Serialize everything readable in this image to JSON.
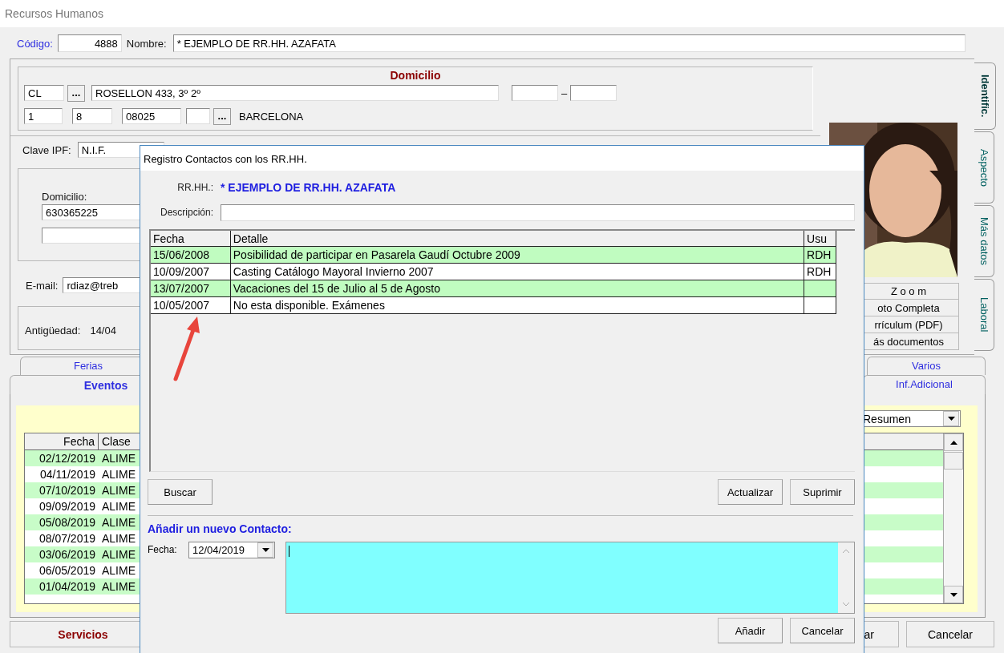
{
  "window": {
    "title": "Recursos Humanos"
  },
  "header": {
    "code_label": "Código:",
    "code": "4888",
    "name_label": "Nombre:",
    "name": "* EJEMPLO DE RR.HH. AZAFATA"
  },
  "address": {
    "title": "Domicilio",
    "street_type": "CL",
    "more_button": "...",
    "street": "ROSELLON 433, 3º 2º",
    "dash": "–",
    "field_1": "1",
    "field_2": "8",
    "postal_code": "08025",
    "city_button": "...",
    "city": "BARCELONA"
  },
  "id_key": {
    "label": "Clave IPF:",
    "value": "N.I.F."
  },
  "contact": {
    "label": "Domicilio:",
    "phone": "630365225"
  },
  "email": {
    "label": "E-mail:",
    "value": "rdiaz@treb"
  },
  "seniority": {
    "label": "Antigüedad:",
    "value": "14/04"
  },
  "photo": {
    "kind": "picture"
  },
  "photo_buttons": [
    "Z o o m",
    "oto Completa",
    "rrículum (PDF)",
    "ás documentos"
  ],
  "side_tabs": [
    {
      "label": "Identific.",
      "selected": true
    },
    {
      "label": "Aspecto",
      "selected": false
    },
    {
      "label": "Más datos",
      "selected": false
    },
    {
      "label": "Laboral",
      "selected": false
    }
  ],
  "lower_tabs_back": [
    {
      "label": "Ferias",
      "selected": false
    },
    {
      "label": "Varios",
      "selected": false
    }
  ],
  "lower_tabs_front": [
    {
      "label": "Eventos",
      "selected": true
    },
    {
      "label": "Inf.Adicional",
      "selected": false
    }
  ],
  "summary_view": "Resumen",
  "events": {
    "columns": [
      "Fecha",
      "Clase"
    ],
    "rows": [
      [
        "02/12/2019",
        "ALIME"
      ],
      [
        "04/11/2019",
        "ALIME"
      ],
      [
        "07/10/2019",
        "ALIME"
      ],
      [
        "09/09/2019",
        "ALIME"
      ],
      [
        "05/08/2019",
        "ALIME"
      ],
      [
        "08/07/2019",
        "ALIME"
      ],
      [
        "03/06/2019",
        "ALIME"
      ],
      [
        "06/05/2019",
        "ALIME"
      ],
      [
        "01/04/2019",
        "ALIME"
      ]
    ]
  },
  "footer_buttons": [
    "Servicios",
    "ar",
    "Cancelar"
  ],
  "dialog": {
    "title": "Registro Contactos con los RR.HH.",
    "employee_label": "RR.HH.:",
    "employee": "* EJEMPLO DE RR.HH. AZAFATA",
    "description_label": "Descripción:",
    "columns": [
      "Fecha",
      "Detalle",
      "Usu"
    ],
    "rows": [
      {
        "date": "15/06/2008",
        "detail": "Posibilidad de participar en Pasarela Gaudí Octubre 2009",
        "user": "RDH"
      },
      {
        "date": "10/09/2007",
        "detail": "Casting Catálogo Mayoral Invierno 2007",
        "user": "RDH"
      },
      {
        "date": "13/07/2007",
        "detail": "Vacaciones del 15 de Julio al 5 de Agosto"
      },
      {
        "date": "10/05/2007",
        "detail": "No esta disponible. Exámenes"
      }
    ],
    "search_button": "Buscar",
    "buttons": [
      "Actualizar",
      "Suprimir"
    ],
    "new_title": "Añadir un nuevo Contacto:",
    "date_label": "Fecha:",
    "date": "12/04/2019",
    "actions": [
      "Añadir",
      "Cancelar"
    ]
  }
}
